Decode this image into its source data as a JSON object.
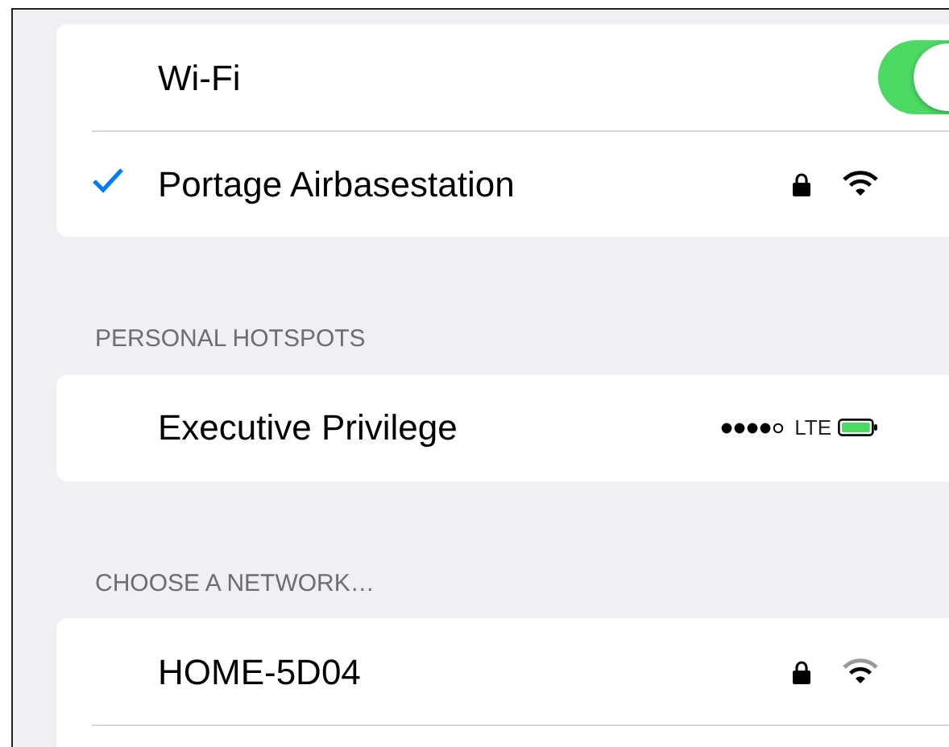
{
  "wifi_group": {
    "rows": [
      {
        "kind": "toggle",
        "label": "Wi-Fi",
        "on": true
      },
      {
        "kind": "network",
        "label": "Portage Airbasestation",
        "selected": true,
        "locked": true,
        "weak_signal": false
      }
    ]
  },
  "hotspots": {
    "header": "PERSONAL HOTSPOTS",
    "rows": [
      {
        "kind": "hotspot",
        "label": "Executive Privilege",
        "carrier": "LTE"
      }
    ]
  },
  "networks": {
    "header": "CHOOSE A NETWORK…",
    "rows": [
      {
        "kind": "network",
        "label": "HOME-5D04",
        "selected": false,
        "locked": true,
        "weak_signal": true
      },
      {
        "kind": "empty"
      }
    ]
  }
}
